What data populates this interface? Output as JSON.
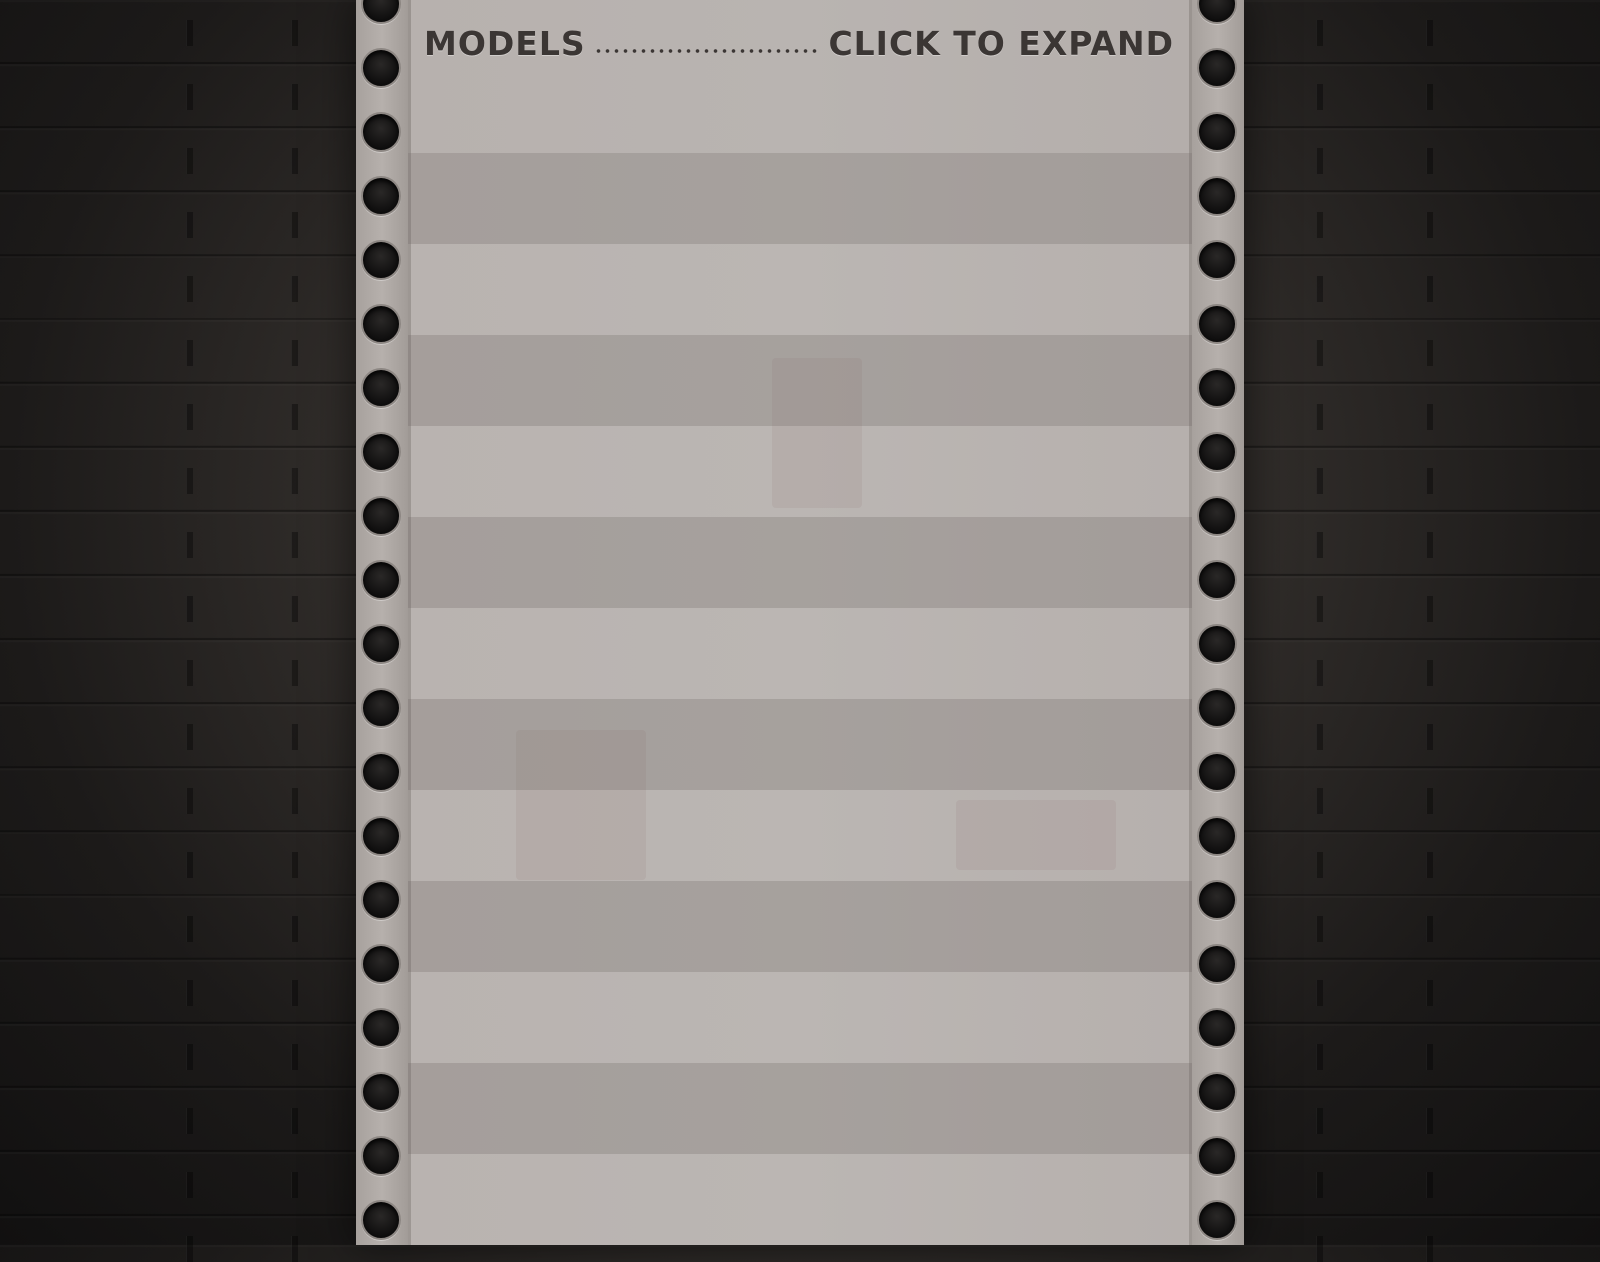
{
  "section": {
    "title": "MODELS",
    "expand_label": "CLICK TO EXPAND"
  },
  "icons": {
    "sprocket": "film-sprocket-hole-icon"
  },
  "colors": {
    "header_text": "#3b3634",
    "strip": "#b9b4b1",
    "background": "#1c1a19"
  }
}
